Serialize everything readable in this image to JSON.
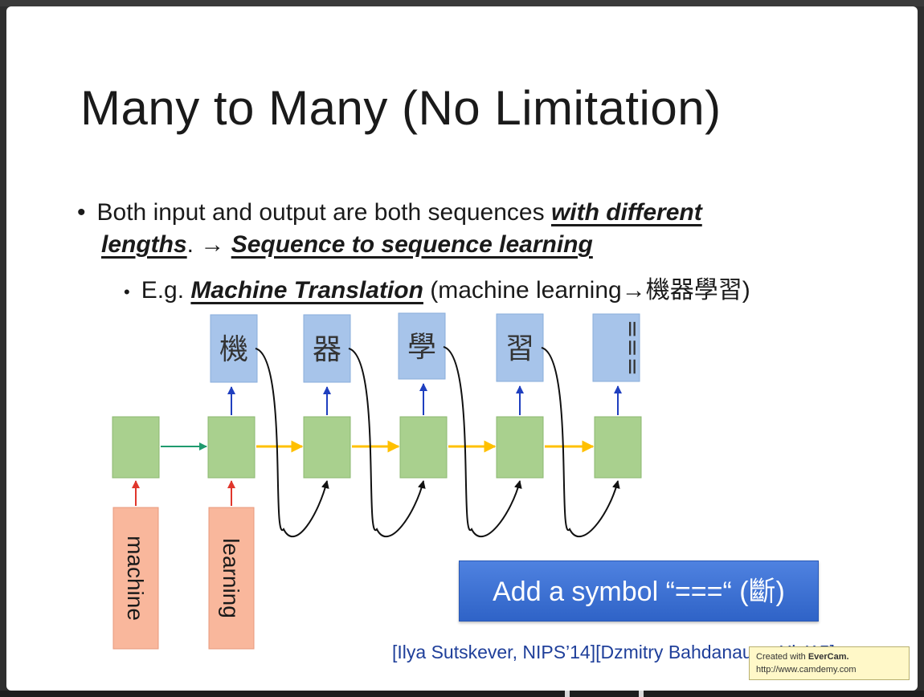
{
  "slide": {
    "title": "Many to Many (No Limitation)",
    "bullet1": {
      "text": "Both input and output are both sequences ",
      "emphasis": "with different",
      "emphasis2": "lengths",
      "arrow_text": ". → ",
      "emphasis3": "Sequence to sequence learning"
    },
    "bullet2": {
      "prefix": "E.g. ",
      "emphasis": "Machine Translation",
      "suffix": " (machine learning→機器學習)"
    }
  },
  "diagram": {
    "inputs": [
      "machine",
      "learning"
    ],
    "outputs": [
      "機",
      "器",
      "學",
      "習",
      "==="
    ],
    "colors": {
      "input_fill": "#f9b79c",
      "cell_fill": "#a9d08e",
      "output_fill": "#a7c4ea",
      "hidden_arrow": "#ffc000",
      "first_arrow": "#1f9a6e",
      "input_arrow": "#e0362c",
      "output_arrow": "#1f3fbf"
    }
  },
  "callout": {
    "text": "Add a symbol “===“ (斷)"
  },
  "citation": "[Ilya Sutskever, NIPS’14][Dzmitry Bahdanau, arXiv’15]",
  "watermark": {
    "line1_prefix": "Created with ",
    "brand": "EverCam.",
    "line2": "http://www.camdemy.com"
  }
}
